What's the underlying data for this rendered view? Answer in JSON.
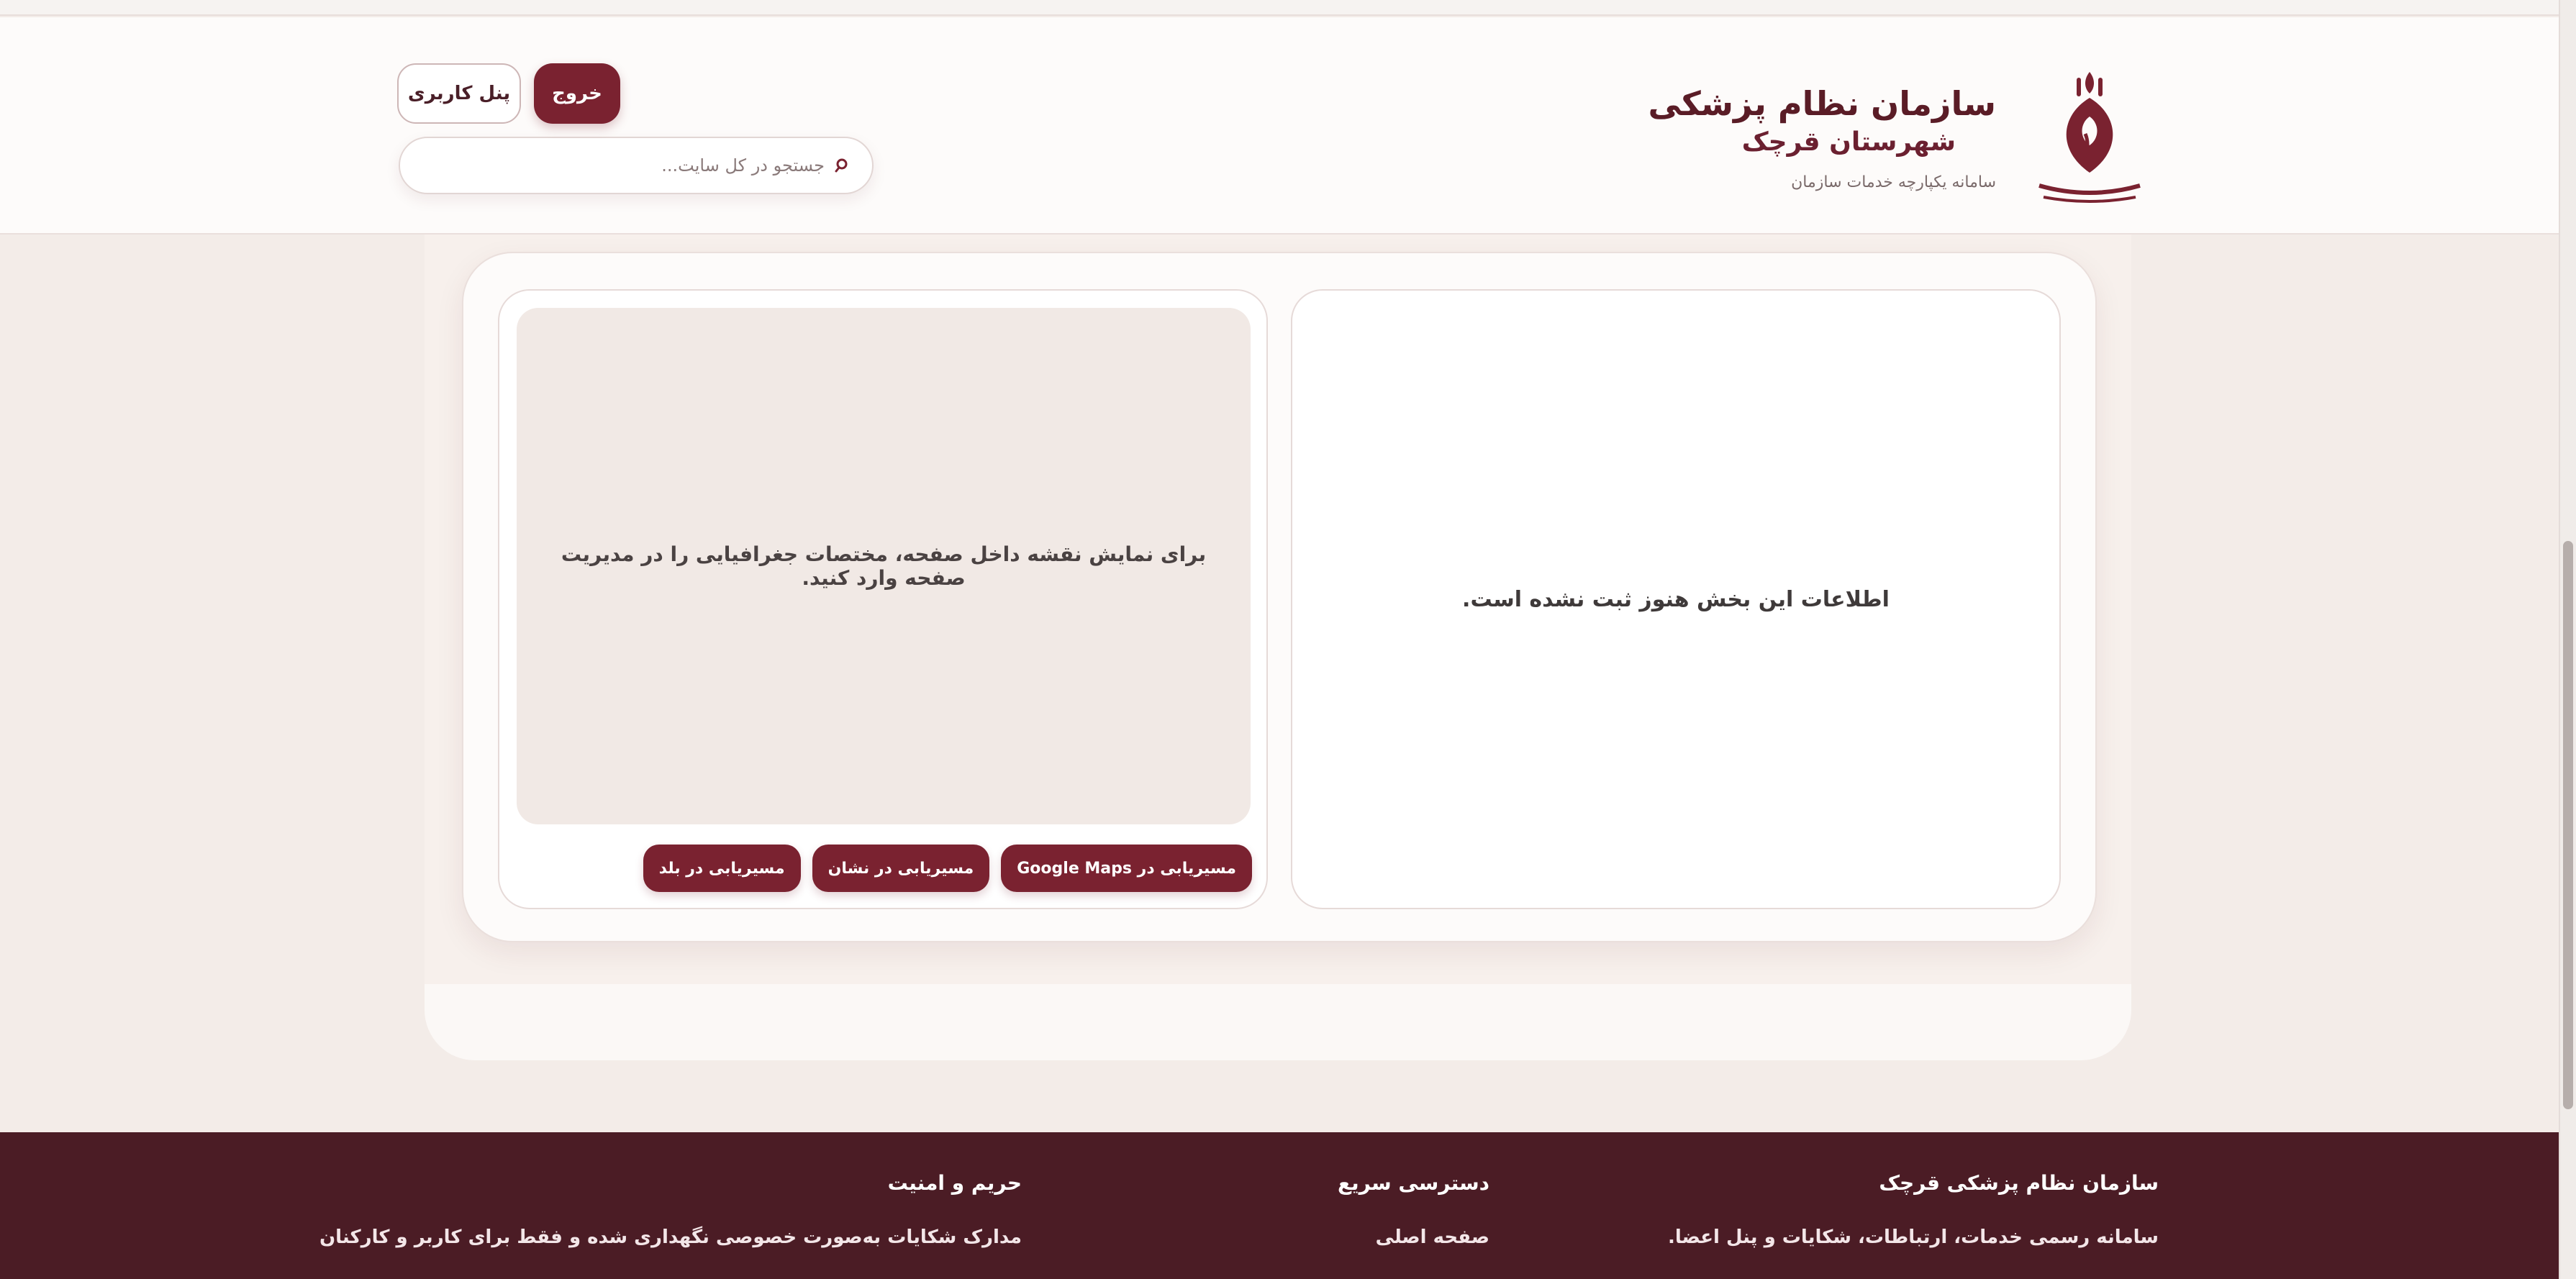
{
  "header": {
    "title": "سازمان نظام پزشکی",
    "subtitle": "شهرستان قرچک",
    "tagline": "سامانه یکپارچه خدمات سازمان",
    "user_panel_label": "پنل کاربری",
    "logout_label": "خروج",
    "search_placeholder": "جستجو در کل سایت..."
  },
  "contact": {
    "info_empty_text": "اطلاعات این بخش هنوز ثبت نشده است.",
    "map_notice": "برای نمایش نقشه داخل صفحه، مختصات جغرافیایی را در مدیریت صفحه وارد کنید.",
    "route_buttons": [
      "مسیریابی در Google Maps",
      "مسیریابی در نشان",
      "مسیریابی در بلد"
    ]
  },
  "footer": {
    "org": {
      "heading": "سازمان نظام پزشکی قرچک",
      "text": "سامانه رسمی خدمات، ارتباطات، شکایات و پنل اعضا."
    },
    "quick": {
      "heading": "دسترسی سریع",
      "link": "صفحه اصلی"
    },
    "privacy": {
      "heading": "حریم و امنیت",
      "text": "مدارک شکایات به‌صورت خصوصی نگهداری شده و فقط برای کاربر و کارکنان"
    }
  },
  "colors": {
    "brand": "#7a2230",
    "footer_bg": "#4b1c25",
    "page_bg": "#f3ece8"
  },
  "icons": {
    "logo": "emblem-logo",
    "search": "search-icon"
  }
}
